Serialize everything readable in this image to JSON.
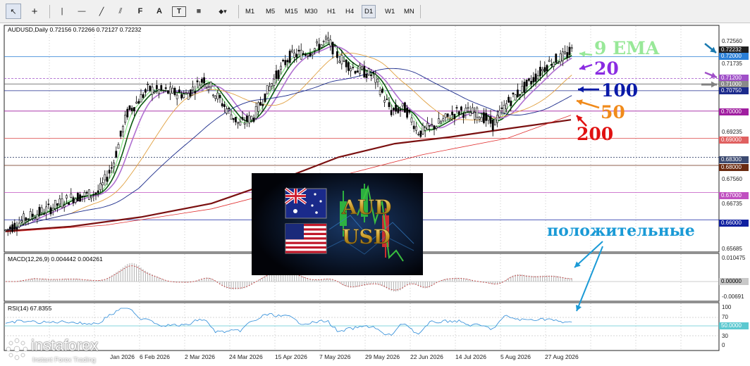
{
  "toolbar": {
    "tools": [
      {
        "icon": "cursor-icon",
        "glyph": "↖"
      },
      {
        "icon": "crosshair-icon",
        "glyph": "+"
      },
      {
        "icon": "vertical-line-icon",
        "glyph": "|"
      },
      {
        "icon": "horizontal-line-icon",
        "glyph": "—"
      },
      {
        "icon": "trendline-icon",
        "glyph": "╱"
      },
      {
        "icon": "channel-icon",
        "glyph": "⫽"
      },
      {
        "icon": "fibonacci-icon",
        "glyph": "F"
      },
      {
        "icon": "text-icon",
        "glyph": "A"
      },
      {
        "icon": "label-icon",
        "glyph": "T"
      },
      {
        "icon": "shapes-icon",
        "glyph": "■"
      },
      {
        "icon": "arrows-icon",
        "glyph": "◆▾"
      }
    ],
    "timeframes": [
      "M1",
      "M5",
      "M15",
      "M30",
      "H1",
      "H4",
      "D1",
      "W1",
      "MN"
    ],
    "active_timeframe": "D1"
  },
  "chart": {
    "symbol_info": "AUDUSD,Daily  0.72156 0.72266 0.72127 0.72232",
    "macd_label": "MACD(12,26,9) 0.004442 0.004261",
    "rsi_label": "RSI(14) 67.8355",
    "price_axis": [
      "0.72560",
      "0.71735",
      "0.69235",
      "0.67560",
      "0.66735",
      "0.65685"
    ],
    "price_tags": [
      {
        "value": "0.72232",
        "color": "#1e1e1e"
      },
      {
        "value": "0.72000",
        "color": "#2a7fd6"
      },
      {
        "value": "0.71200",
        "color": "#a050c8"
      },
      {
        "value": "0.71000",
        "color": "#8a8a8a"
      },
      {
        "value": "0.70750",
        "color": "#1c2a8c"
      },
      {
        "value": "0.70000",
        "color": "#a01ea0"
      },
      {
        "value": "0.69000",
        "color": "#e06060"
      },
      {
        "value": "0.68300",
        "color": "#3c4a70"
      },
      {
        "value": "0.68000",
        "color": "#6a2a10"
      },
      {
        "value": "0.67000",
        "color": "#c050c0"
      },
      {
        "value": "0.66000",
        "color": "#1020a0"
      }
    ],
    "macd_axis": [
      "0.010475",
      "0.00000",
      "-0.00691"
    ],
    "rsi_axis": [
      "100",
      "70",
      "50.0000",
      "30",
      "0"
    ],
    "dates": [
      "6 Feb 2026",
      "2 Mar 2026",
      "24 Mar 2026",
      "15 Apr 2026",
      "7 May 2026",
      "29 May 2026",
      "22 Jun 2026",
      "14 Jul 2026",
      "5 Aug 2026",
      "27 Aug 2026"
    ],
    "clipped_date_fragment": "Jan 2026"
  },
  "annotations": {
    "ema9": {
      "text": "9 EMA",
      "color": "#98e898"
    },
    "ma20": {
      "text": "20",
      "color": "#8a2be2"
    },
    "ma100": {
      "text": "100",
      "color": "#0a1aa8"
    },
    "ma50": {
      "text": "50",
      "color": "#f08a1a"
    },
    "ma200": {
      "text": "200",
      "color": "#e01010"
    },
    "positive": {
      "text": "положительные",
      "color": "#1a9ad6"
    }
  },
  "logo_image": {
    "pair_top": "AUD",
    "pair_bottom": "USD"
  },
  "watermark": {
    "brand": "instaforex",
    "tagline": "Instant Forex Trading"
  }
}
